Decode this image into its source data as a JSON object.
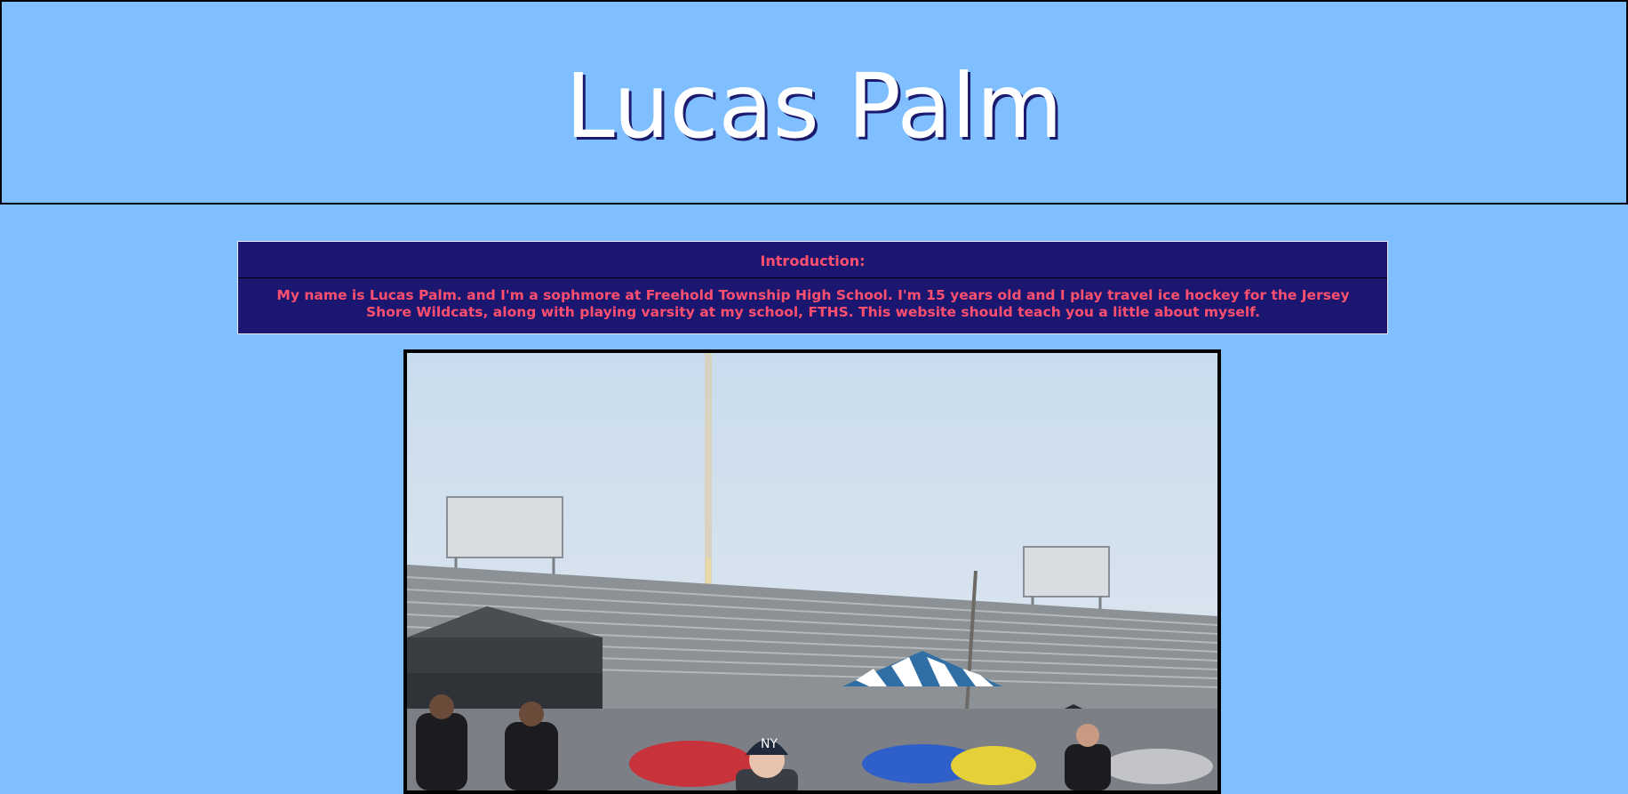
{
  "header": {
    "title": "Lucas Palm"
  },
  "intro": {
    "heading": "Introduction:",
    "body": "My name is Lucas Palm. and I'm a sophmore at Freehold Township High School. I'm 15 years old and I play travel ice hockey for the Jersey Shore Wildcats, along with playing varsity at my school, FTHS. This website should teach you a little about myself."
  },
  "photo": {
    "alt": "photo"
  },
  "colors": {
    "background": "#80bfff",
    "intro_bg": "#1b1670",
    "intro_text": "#ff4f6e",
    "title_text": "#ffffff"
  }
}
